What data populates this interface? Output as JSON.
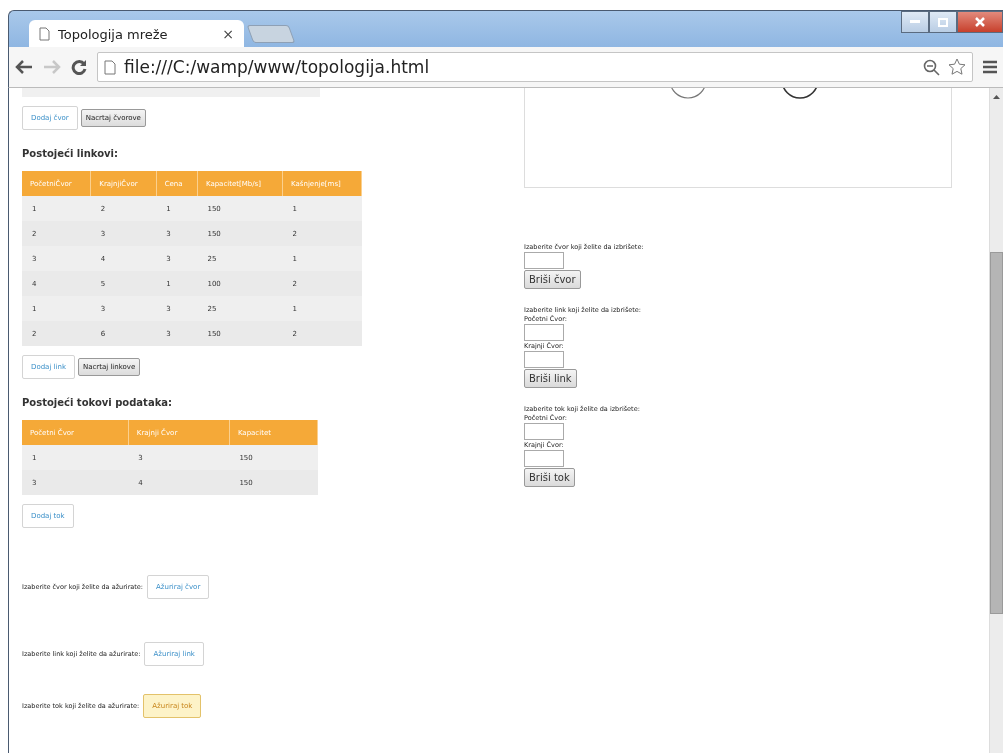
{
  "browser": {
    "tab": {
      "title": "Topologija mreže",
      "close": "×"
    },
    "forward_disabled": true,
    "address": "file:///C:/wamp/www/topologija.html"
  },
  "node_actions": [
    {
      "label": "Dodaj čvor",
      "kind": "primary"
    },
    {
      "label": "Nacrtaj čvorove",
      "kind": "plain"
    }
  ],
  "links": {
    "heading": "Postojeći linkovi:",
    "columns": [
      "PočetniČvor",
      "KrajnjiČvor",
      "Cena",
      "Kapacitet[Mb/s]",
      "Kašnjenje[ms]"
    ],
    "rows": [
      [
        "1",
        "2",
        "1",
        "150",
        "1"
      ],
      [
        "2",
        "3",
        "3",
        "150",
        "2"
      ],
      [
        "3",
        "4",
        "3",
        "25",
        "1"
      ],
      [
        "4",
        "5",
        "1",
        "100",
        "2"
      ],
      [
        "1",
        "3",
        "3",
        "25",
        "1"
      ],
      [
        "2",
        "6",
        "3",
        "150",
        "2"
      ]
    ]
  },
  "link_actions": [
    {
      "label": "Dodaj link",
      "kind": "primary"
    },
    {
      "label": "Nacrtaj linkove",
      "kind": "plain"
    }
  ],
  "flows": {
    "heading": "Postojeći tokovi podataka:",
    "columns": [
      "Početni Čvor",
      "Krajnji Čvor",
      "Kapacitet"
    ],
    "rows": [
      [
        "1",
        "3",
        "150"
      ],
      [
        "3",
        "4",
        "150"
      ]
    ]
  },
  "flow_actions": [
    {
      "label": "Dodaj tok",
      "kind": "primary"
    }
  ],
  "updates": [
    {
      "label": "Izaberite čvor koji želite da ažurirate:",
      "button": "Ažuriraj čvor",
      "highlighted": false
    },
    {
      "label": "Izaberite link koji želite da ažurirate:",
      "button": "Ažuriraj link",
      "highlighted": false
    },
    {
      "label": "Izaberite tok koji želite da ažurirate:",
      "button": "Ažuriraj tok",
      "highlighted": true
    }
  ],
  "deletes": [
    {
      "label": "Izaberite čvor koji želite da izbrišete:",
      "fields": [
        {
          "kind": "bare"
        }
      ],
      "button": "Briši čvor"
    },
    {
      "label": "Izaberite link koji želite da izbrišete:",
      "fields": [
        {
          "kind": "labeled",
          "label": "Početni Čvor:"
        },
        {
          "kind": "labeled",
          "label": "Krajnji Čvor:"
        }
      ],
      "button": "Briši link"
    },
    {
      "label": "Izaberite tok koji želite da izbrišete:",
      "fields": [
        {
          "kind": "labeled",
          "label": "Početni Čvor:"
        },
        {
          "kind": "labeled",
          "label": "Krajnji Čvor:"
        }
      ],
      "button": "Briši tok"
    }
  ]
}
